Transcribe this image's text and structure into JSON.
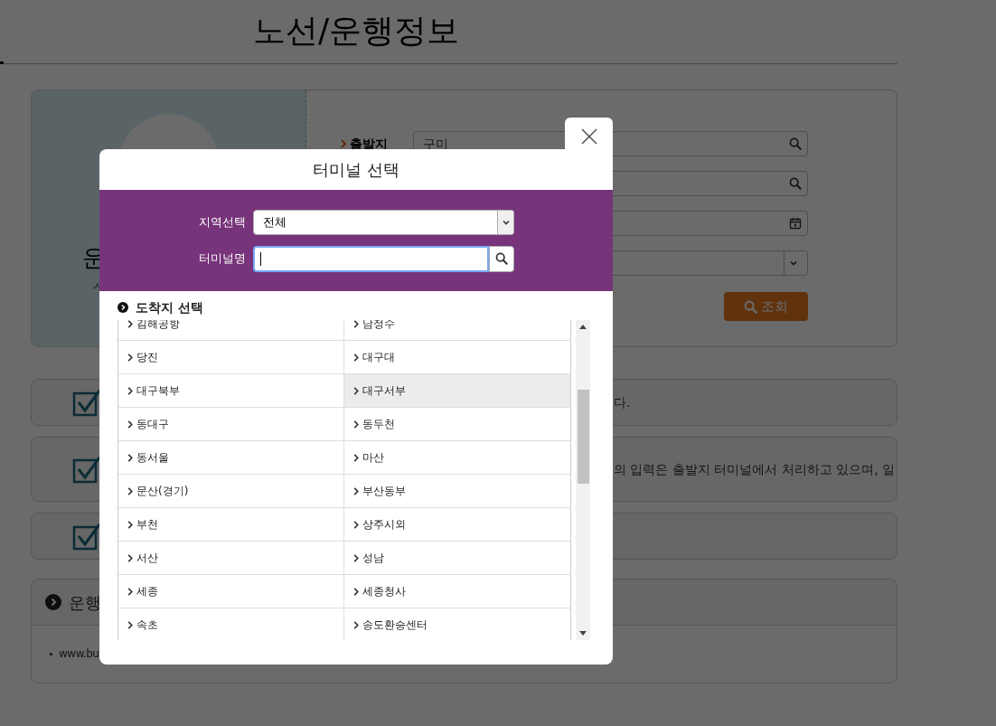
{
  "page": {
    "title": "노선/운행정보"
  },
  "search_form": {
    "panel_texts": [
      "운",
      "ㅅ"
    ],
    "fields": [
      {
        "kind": "search",
        "label": "출발지",
        "value": "구미"
      },
      {
        "kind": "search"
      },
      {
        "kind": "date"
      },
      {
        "kind": "select"
      }
    ],
    "submit": "조회"
  },
  "notices": [
    {
      "kind": "checkbox",
      "text": "다."
    },
    {
      "kind": "checkbox",
      "text": "의 입력은 출발지 터미널에서 처리하고 있으며, 일"
    },
    {
      "kind": "checkbox"
    }
  ],
  "info_box": {
    "title": "운행",
    "items": [
      "www.bu"
    ]
  },
  "modal": {
    "title": "터미널 선택",
    "region_label": "지역선택",
    "region_value": "전체",
    "name_label": "터미널명",
    "section_title": "도착지 선택",
    "terminals": [
      {
        "name": "김해공항",
        "selected": false
      },
      {
        "name": "남정수",
        "selected": false
      },
      {
        "name": "당진",
        "selected": false
      },
      {
        "name": "대구대",
        "selected": false
      },
      {
        "name": "대구북부",
        "selected": false
      },
      {
        "name": "대구서부",
        "selected": true
      },
      {
        "name": "동대구",
        "selected": false
      },
      {
        "name": "동두천",
        "selected": false
      },
      {
        "name": "동서울",
        "selected": false
      },
      {
        "name": "마산",
        "selected": false
      },
      {
        "name": "문산(경기)",
        "selected": false
      },
      {
        "name": "부산동부",
        "selected": false
      },
      {
        "name": "부천",
        "selected": false
      },
      {
        "name": "상주시외",
        "selected": false
      },
      {
        "name": "서산",
        "selected": false
      },
      {
        "name": "성남",
        "selected": false
      },
      {
        "name": "세종",
        "selected": false
      },
      {
        "name": "세종청사",
        "selected": false
      },
      {
        "name": "속초",
        "selected": false
      },
      {
        "name": "송도환승센터",
        "selected": false
      }
    ]
  }
}
